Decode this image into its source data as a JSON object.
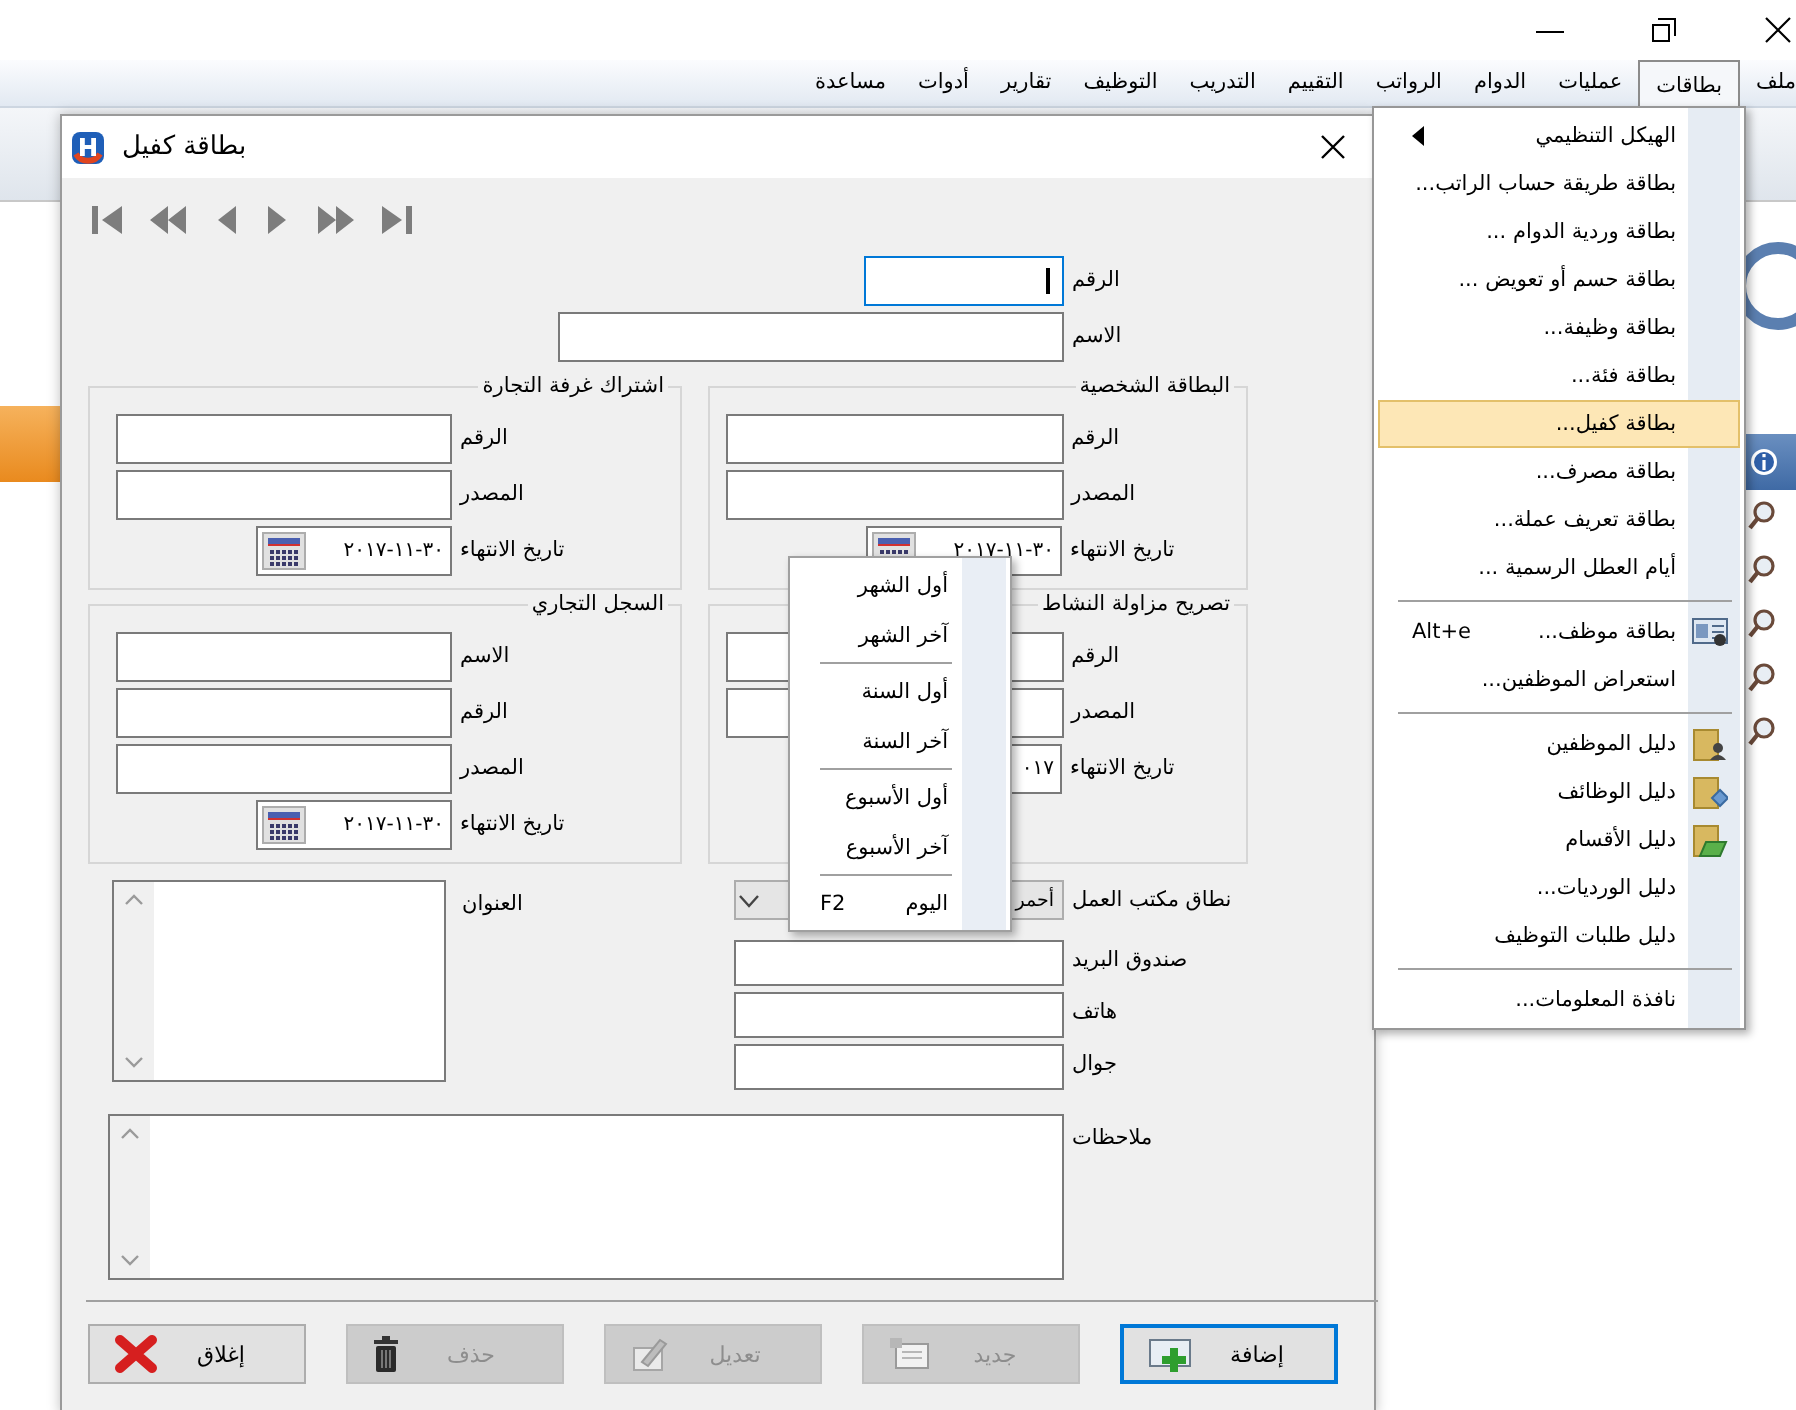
{
  "menu_bar": [
    {
      "label": "ملف",
      "selected": false
    },
    {
      "label": "بطاقات",
      "selected": true
    },
    {
      "label": "عمليات",
      "selected": false
    },
    {
      "label": "الدوام",
      "selected": false
    },
    {
      "label": "الرواتب",
      "selected": false
    },
    {
      "label": "التقييم",
      "selected": false
    },
    {
      "label": "التدريب",
      "selected": false
    },
    {
      "label": "التوظيف",
      "selected": false
    },
    {
      "label": "تقارير",
      "selected": false
    },
    {
      "label": "أدوات",
      "selected": false
    },
    {
      "label": "مساعدة",
      "selected": false
    }
  ],
  "menu": {
    "items": [
      {
        "kind": "item",
        "label": "الهيكل التنظيمي",
        "submenu": true,
        "selected": false
      },
      {
        "kind": "item",
        "label": "بطاقة طريقة حساب الراتب...",
        "submenu": false,
        "selected": false
      },
      {
        "kind": "item",
        "label": "بطاقة وردية الدوام ...",
        "submenu": false,
        "selected": false
      },
      {
        "kind": "item",
        "label": "بطاقة حسم أو تعويض ...",
        "submenu": false,
        "selected": false
      },
      {
        "kind": "item",
        "label": "بطاقة وظيفة...",
        "submenu": false,
        "selected": false
      },
      {
        "kind": "item",
        "label": "بطاقة فئة...",
        "submenu": false,
        "selected": false
      },
      {
        "kind": "item",
        "label": "بطاقة كفيل...",
        "submenu": false,
        "selected": true
      },
      {
        "kind": "item",
        "label": "بطاقة مصرف...",
        "submenu": false,
        "selected": false
      },
      {
        "kind": "item",
        "label": "بطاقة تعريف عملة...",
        "submenu": false,
        "selected": false
      },
      {
        "kind": "item",
        "label": "أيام العطل الرسمية ...",
        "submenu": false,
        "selected": false
      },
      {
        "kind": "separator"
      },
      {
        "kind": "item",
        "label": "بطاقة موظف...",
        "shortcut": "Alt+e",
        "submenu": false,
        "selected": false
      },
      {
        "kind": "item",
        "label": "استعراض الموظفين...",
        "submenu": false,
        "selected": false
      },
      {
        "kind": "separator"
      },
      {
        "kind": "item",
        "label": "دليل الموظفين",
        "submenu": false,
        "selected": false
      },
      {
        "kind": "item",
        "label": "دليل الوظائف",
        "submenu": false,
        "selected": false
      },
      {
        "kind": "item",
        "label": "دليل الأقسام",
        "submenu": false,
        "selected": false
      },
      {
        "kind": "item",
        "label": "دليل الورديات...",
        "submenu": false,
        "selected": false
      },
      {
        "kind": "item",
        "label": "دليل طلبات التوظيف",
        "submenu": false,
        "selected": false
      },
      {
        "kind": "separator"
      },
      {
        "kind": "item",
        "label": "نافذة المعلومات...",
        "submenu": false,
        "selected": false
      }
    ]
  },
  "dialog": {
    "title": "بطاقة كفيل",
    "top_fields": [
      {
        "label": "الرقم",
        "focused": true
      },
      {
        "label": "الاسم",
        "focused": false
      }
    ],
    "groups": [
      {
        "title": "البطاقة الشخصية",
        "rows": [
          {
            "kind": "text",
            "label": "الرقم"
          },
          {
            "kind": "text",
            "label": "المصدر"
          },
          {
            "kind": "date",
            "label": "تاريخ الانتهاء",
            "value": "٣٠-١١-٢٠١٧",
            "calendar_button": true
          }
        ]
      },
      {
        "title": "اشتراك غرفة التجارة",
        "rows": [
          {
            "kind": "text",
            "label": "الرقم"
          },
          {
            "kind": "text",
            "label": "المصدر"
          },
          {
            "kind": "date",
            "label": "تاريخ الانتهاء",
            "value": "٣٠-١١-٢٠١٧",
            "calendar_button": true
          }
        ]
      },
      {
        "title": "تصريح مزاولة النشاط",
        "rows": [
          {
            "kind": "text",
            "label": "الرقم"
          },
          {
            "kind": "text",
            "label": "المصدر"
          },
          {
            "kind": "date",
            "label": "تاريخ الانتهاء",
            "value": "٠١٧"
          }
        ]
      },
      {
        "title": "السجل التجاري",
        "rows": [
          {
            "kind": "text",
            "label": "الاسم"
          },
          {
            "kind": "text",
            "label": "الرقم"
          },
          {
            "kind": "text",
            "label": "المصدر"
          },
          {
            "kind": "date",
            "label": "تاريخ الانتهاء",
            "value": "٣٠-١١-٢٠١٧",
            "calendar_button": true
          }
        ]
      }
    ],
    "work_office": {
      "label": "نطاق مكتب العمل",
      "value": "أحمر"
    },
    "contact_fields": [
      {
        "label": "صندوق البريد"
      },
      {
        "label": "هاتف"
      },
      {
        "label": "جوال"
      }
    ],
    "address": {
      "label": "العنوان"
    },
    "notes": {
      "label": "ملاحظات"
    },
    "buttons": [
      {
        "kind": "add",
        "label": "إضافة",
        "disabled": false,
        "default": true
      },
      {
        "kind": "new",
        "label": "جديد",
        "disabled": true,
        "default": false
      },
      {
        "kind": "edit",
        "label": "تعديل",
        "disabled": true,
        "default": false
      },
      {
        "kind": "delete",
        "label": "حذف",
        "disabled": true,
        "default": false
      },
      {
        "kind": "close",
        "label": "إغلاق",
        "disabled": false,
        "default": false
      }
    ]
  },
  "context_menu": {
    "items": [
      {
        "kind": "item",
        "label": "أول الشهر"
      },
      {
        "kind": "item",
        "label": "آخر الشهر"
      },
      {
        "kind": "separator"
      },
      {
        "kind": "item",
        "label": "أول السنة"
      },
      {
        "kind": "item",
        "label": "آخر السنة"
      },
      {
        "kind": "separator"
      },
      {
        "kind": "item",
        "label": "أول الأسبوع"
      },
      {
        "kind": "item",
        "label": "آخر الأسبوع"
      },
      {
        "kind": "separator"
      },
      {
        "kind": "item",
        "label": "اليوم",
        "shortcut": "F2"
      }
    ]
  }
}
